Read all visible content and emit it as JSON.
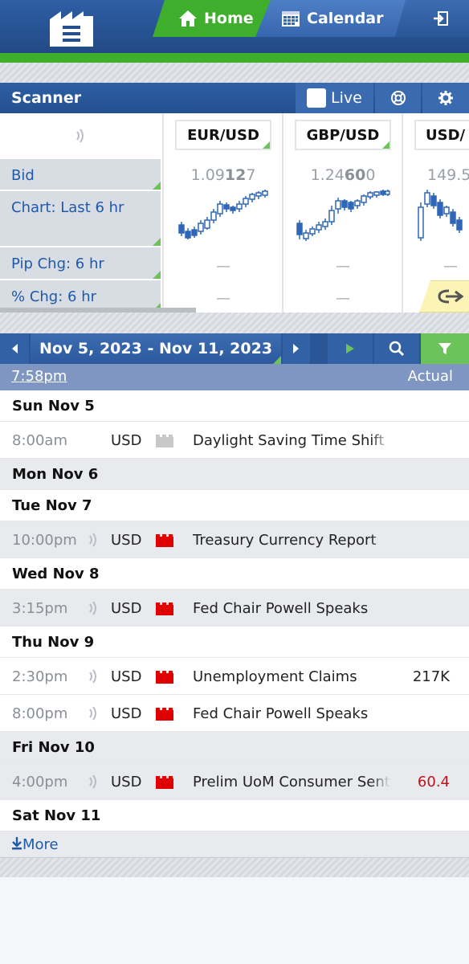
{
  "nav": {
    "home_label": "Home",
    "calendar_label": "Calendar"
  },
  "scanner": {
    "title": "Scanner",
    "live_label": "Live",
    "row_labels": [
      "Bid",
      "Chart: Last 6 hr",
      "Pip Chg: 6 hr",
      "% Chg: 6 hr"
    ],
    "pairs": [
      {
        "name": "EUR/USD",
        "bid_pre": "1.09",
        "bid_bold": "12",
        "bid_post": "7",
        "pip": "—",
        "pct": "—"
      },
      {
        "name": "GBP/USD",
        "bid_pre": "1.24",
        "bid_bold": "60",
        "bid_post": "0",
        "pip": "—",
        "pct": "—"
      },
      {
        "name": "USD/",
        "bid_pre": "149.5",
        "bid_bold": "",
        "bid_post": "",
        "pip": "—",
        "pct": ""
      }
    ]
  },
  "calendar": {
    "range": "Nov 5, 2023 - Nov 11, 2023",
    "now_time": "7:58pm",
    "actual_header": "Actual",
    "days": [
      {
        "label": "Sun Nov 5",
        "events": [
          {
            "time": "8:00am",
            "currency": "USD",
            "impact": "none",
            "name": "Daylight Saving Time Shift",
            "actual": "",
            "sound": false
          }
        ]
      },
      {
        "label": "Mon Nov 6",
        "events": []
      },
      {
        "label": "Tue Nov 7",
        "events": [
          {
            "time": "10:00pm",
            "currency": "USD",
            "impact": "high",
            "name": "Treasury Currency Report",
            "actual": "",
            "sound": true
          }
        ]
      },
      {
        "label": "Wed Nov 8",
        "events": [
          {
            "time": "3:15pm",
            "currency": "USD",
            "impact": "high",
            "name": "Fed Chair Powell Speaks",
            "actual": "",
            "sound": true
          }
        ]
      },
      {
        "label": "Thu Nov 9",
        "events": [
          {
            "time": "2:30pm",
            "currency": "USD",
            "impact": "high",
            "name": "Unemployment Claims",
            "actual": "217K",
            "actual_color": "normal",
            "sound": true
          },
          {
            "time": "8:00pm",
            "currency": "USD",
            "impact": "high",
            "name": "Fed Chair Powell Speaks",
            "actual": "",
            "sound": true
          }
        ]
      },
      {
        "label": "Fri Nov 10",
        "events": [
          {
            "time": "4:00pm",
            "currency": "USD",
            "impact": "high",
            "name": "Prelim UoM Consumer Sentiment",
            "actual": "60.4",
            "actual_color": "red",
            "sound": true
          }
        ]
      },
      {
        "label": "Sat Nov 11",
        "events": []
      }
    ],
    "more_label": "More"
  },
  "colors": {
    "nav_blue": "#2f5ea5",
    "accent_green": "#3fae2c",
    "impact_high": "#e00000",
    "impact_none": "#c8c8c8",
    "actual_red": "#c1121c"
  }
}
